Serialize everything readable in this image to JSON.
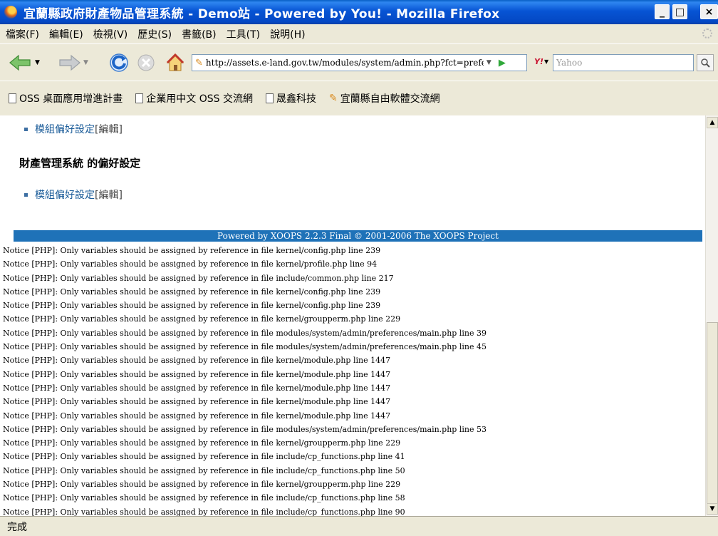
{
  "window": {
    "title": "宜蘭縣政府財產物品管理系統 - Demo站 - Powered by You! - Mozilla Firefox"
  },
  "window_buttons": {
    "minimize": "_",
    "maximize": "□",
    "close": "×"
  },
  "menu": [
    {
      "label": "檔案(F)"
    },
    {
      "label": "編輯(E)"
    },
    {
      "label": "檢視(V)"
    },
    {
      "label": "歷史(S)"
    },
    {
      "label": "書籤(B)"
    },
    {
      "label": "工具(T)"
    },
    {
      "label": "說明(H)"
    }
  ],
  "nav": {
    "url": "http://assets.e-land.gov.tw/modules/system/admin.php?fct=preferences",
    "search_placeholder": "Yahoo"
  },
  "bookmarks": [
    {
      "label": "OSS 桌面應用增進計畫"
    },
    {
      "label": "企業用中文 OSS 交流網"
    },
    {
      "label": "晟鑫科技"
    },
    {
      "label": "宜蘭縣自由軟體交流網"
    }
  ],
  "content": {
    "item1": {
      "link": "模組偏好設定",
      "bracket": "[編輯]"
    },
    "heading": "財產管理系統 的偏好設定",
    "item2": {
      "link": "模組偏好設定",
      "bracket": "[編輯]"
    },
    "footer": "Powered by XOOPS 2.2.3 Final © 2001-2006 The XOOPS Project",
    "notices": [
      "Notice [PHP]: Only variables should be assigned by reference in file kernel/config.php line 239",
      "Notice [PHP]: Only variables should be assigned by reference in file kernel/profile.php line 94",
      "Notice [PHP]: Only variables should be assigned by reference in file include/common.php line 217",
      "Notice [PHP]: Only variables should be assigned by reference in file kernel/config.php line 239",
      "Notice [PHP]: Only variables should be assigned by reference in file kernel/config.php line 239",
      "Notice [PHP]: Only variables should be assigned by reference in file kernel/groupperm.php line 229",
      "Notice [PHP]: Only variables should be assigned by reference in file modules/system/admin/preferences/main.php line 39",
      "Notice [PHP]: Only variables should be assigned by reference in file modules/system/admin/preferences/main.php line 45",
      "Notice [PHP]: Only variables should be assigned by reference in file kernel/module.php line 1447",
      "Notice [PHP]: Only variables should be assigned by reference in file kernel/module.php line 1447",
      "Notice [PHP]: Only variables should be assigned by reference in file kernel/module.php line 1447",
      "Notice [PHP]: Only variables should be assigned by reference in file kernel/module.php line 1447",
      "Notice [PHP]: Only variables should be assigned by reference in file kernel/module.php line 1447",
      "Notice [PHP]: Only variables should be assigned by reference in file modules/system/admin/preferences/main.php line 53",
      "Notice [PHP]: Only variables should be assigned by reference in file kernel/groupperm.php line 229",
      "Notice [PHP]: Only variables should be assigned by reference in file include/cp_functions.php line 41",
      "Notice [PHP]: Only variables should be assigned by reference in file include/cp_functions.php line 50",
      "Notice [PHP]: Only variables should be assigned by reference in file kernel/groupperm.php line 229",
      "Notice [PHP]: Only variables should be assigned by reference in file include/cp_functions.php line 58",
      "Notice [PHP]: Only variables should be assigned by reference in file include/cp_functions.php line 90"
    ]
  },
  "status": {
    "text": "完成"
  },
  "colors": {
    "titlebar": "#0754d4",
    "footer": "#1f72b8",
    "link": "#1b5c99"
  }
}
